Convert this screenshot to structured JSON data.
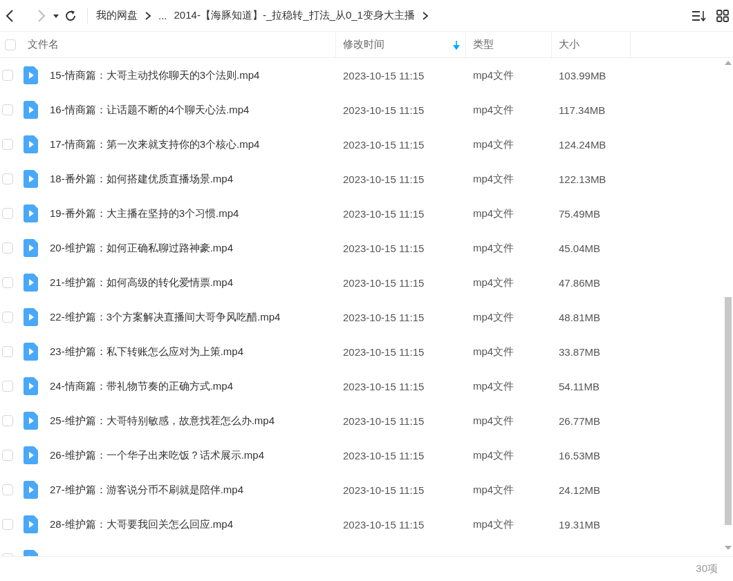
{
  "toolbar": {
    "back_disabled": false,
    "forward_disabled": true,
    "breadcrumb": [
      "我的网盘",
      "...",
      "2014-【海豚知道】-_拉稳转_打法_从0_1变身大主播"
    ]
  },
  "table": {
    "all_checked": false,
    "columns": [
      {
        "label": "文件名",
        "sorted": false
      },
      {
        "label": "修改时间",
        "sorted": true
      },
      {
        "label": "类型",
        "sorted": false
      },
      {
        "label": "大小",
        "sorted": false
      }
    ],
    "rows": [
      {
        "checked": false,
        "name": "15-情商篇：大哥主动找你聊天的3个法则.mp4",
        "modified": "2023-10-15 11:15",
        "type": "mp4文件",
        "size": "103.99MB"
      },
      {
        "checked": false,
        "name": "16-情商篇：让话题不断的4个聊天心法.mp4",
        "modified": "2023-10-15 11:15",
        "type": "mp4文件",
        "size": "117.34MB"
      },
      {
        "checked": false,
        "name": "17-情商篇：第一次来就支持你的3个核心.mp4",
        "modified": "2023-10-15 11:15",
        "type": "mp4文件",
        "size": "124.24MB"
      },
      {
        "checked": false,
        "name": "18-番外篇：如何搭建优质直播场景.mp4",
        "modified": "2023-10-15 11:15",
        "type": "mp4文件",
        "size": "122.13MB"
      },
      {
        "checked": false,
        "name": "19-番外篇：大主播在坚持的3个习惯.mp4",
        "modified": "2023-10-15 11:15",
        "type": "mp4文件",
        "size": "75.49MB"
      },
      {
        "checked": false,
        "name": "20-维护篇：如何正确私聊过路神豪.mp4",
        "modified": "2023-10-15 11:15",
        "type": "mp4文件",
        "size": "45.04MB"
      },
      {
        "checked": false,
        "name": "21-维护篇：如何高级的转化爱情票.mp4",
        "modified": "2023-10-15 11:15",
        "type": "mp4文件",
        "size": "47.86MB"
      },
      {
        "checked": false,
        "name": "22-维护篇：3个方案解决直播间大哥争风吃醋.mp4",
        "modified": "2023-10-15 11:15",
        "type": "mp4文件",
        "size": "48.81MB"
      },
      {
        "checked": false,
        "name": "23-维护篇：私下转账怎么应对为上策.mp4",
        "modified": "2023-10-15 11:15",
        "type": "mp4文件",
        "size": "33.87MB"
      },
      {
        "checked": false,
        "name": "24-情商篇：带礼物节奏的正确方式.mp4",
        "modified": "2023-10-15 11:15",
        "type": "mp4文件",
        "size": "54.11MB"
      },
      {
        "checked": false,
        "name": "25-维护篇：大哥特别敏感，故意找茬怎么办.mp4",
        "modified": "2023-10-15 11:15",
        "type": "mp4文件",
        "size": "26.77MB"
      },
      {
        "checked": false,
        "name": "26-维护篇：一个华子出来吃饭？话术展示.mp4",
        "modified": "2023-10-15 11:15",
        "type": "mp4文件",
        "size": "16.53MB"
      },
      {
        "checked": false,
        "name": "27-维护篇：游客说分币不刷就是陪伴.mp4",
        "modified": "2023-10-15 11:15",
        "type": "mp4文件",
        "size": "24.12MB"
      },
      {
        "checked": false,
        "name": "28-维护篇：大哥要我回关怎么回应.mp4",
        "modified": "2023-10-15 11:15",
        "type": "mp4文件",
        "size": "19.31MB"
      },
      {
        "checked": false
      }
    ]
  },
  "status_bar": {
    "count": "30项"
  }
}
